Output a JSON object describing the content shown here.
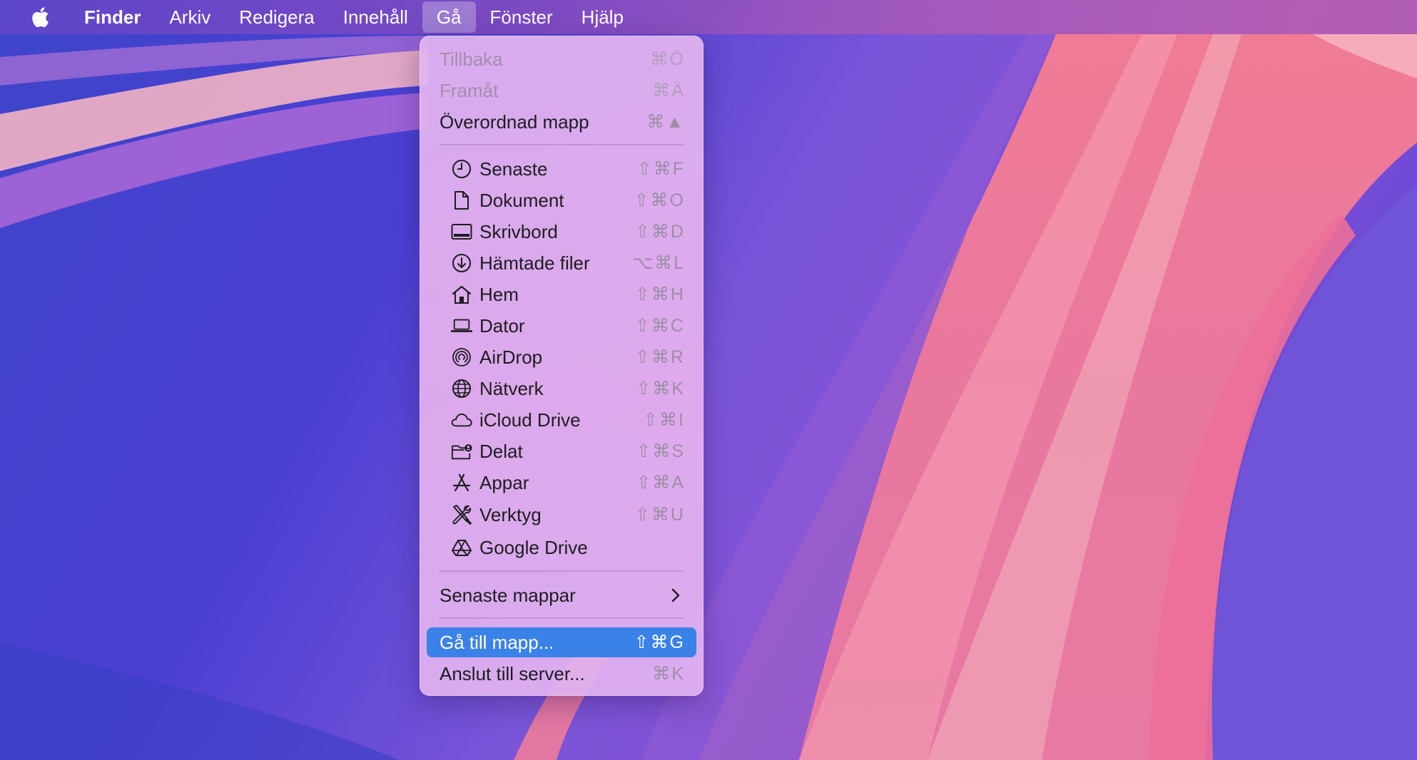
{
  "menubar": {
    "app": "Finder",
    "items": [
      "Arkiv",
      "Redigera",
      "Innehåll",
      "Gå",
      "Fönster",
      "Hjälp"
    ],
    "active": "Gå"
  },
  "menu": {
    "nav": [
      {
        "label": "Tillbaka",
        "shortcut": "⌘Ö",
        "enabled": false
      },
      {
        "label": "Framåt",
        "shortcut": "⌘Ä",
        "enabled": false
      },
      {
        "label": "Överordnad mapp",
        "shortcut": "⌘▲",
        "enabled": true
      }
    ],
    "places": [
      {
        "label": "Senaste",
        "shortcut": "⇧⌘F",
        "icon": "clock-icon"
      },
      {
        "label": "Dokument",
        "shortcut": "⇧⌘O",
        "icon": "document-icon"
      },
      {
        "label": "Skrivbord",
        "shortcut": "⇧⌘D",
        "icon": "desktop-icon"
      },
      {
        "label": "Hämtade filer",
        "shortcut": "⌥⌘L",
        "icon": "download-icon"
      },
      {
        "label": "Hem",
        "shortcut": "⇧⌘H",
        "icon": "home-icon"
      },
      {
        "label": "Dator",
        "shortcut": "⇧⌘C",
        "icon": "laptop-icon"
      },
      {
        "label": "AirDrop",
        "shortcut": "⇧⌘R",
        "icon": "airdrop-icon"
      },
      {
        "label": "Nätverk",
        "shortcut": "⇧⌘K",
        "icon": "globe-icon"
      },
      {
        "label": "iCloud Drive",
        "shortcut": "⇧⌘I",
        "icon": "cloud-icon"
      },
      {
        "label": "Delat",
        "shortcut": "⇧⌘S",
        "icon": "shared-folder-icon"
      },
      {
        "label": "Appar",
        "shortcut": "⇧⌘A",
        "icon": "apps-icon"
      },
      {
        "label": "Verktyg",
        "shortcut": "⇧⌘U",
        "icon": "tools-icon"
      },
      {
        "label": "Google Drive",
        "shortcut": "",
        "icon": "google-drive-icon"
      }
    ],
    "recent_folders": "Senaste mappar",
    "go_to_folder": {
      "label": "Gå till mapp...",
      "shortcut": "⇧⌘G"
    },
    "connect_server": {
      "label": "Anslut till server...",
      "shortcut": "⌘K"
    }
  },
  "colors": {
    "highlight": "#3b82e8",
    "menu_bg": "#e3b4ef",
    "wallpaper_blue": "#4a3fd0",
    "wallpaper_pink": "#ec7f9e"
  }
}
